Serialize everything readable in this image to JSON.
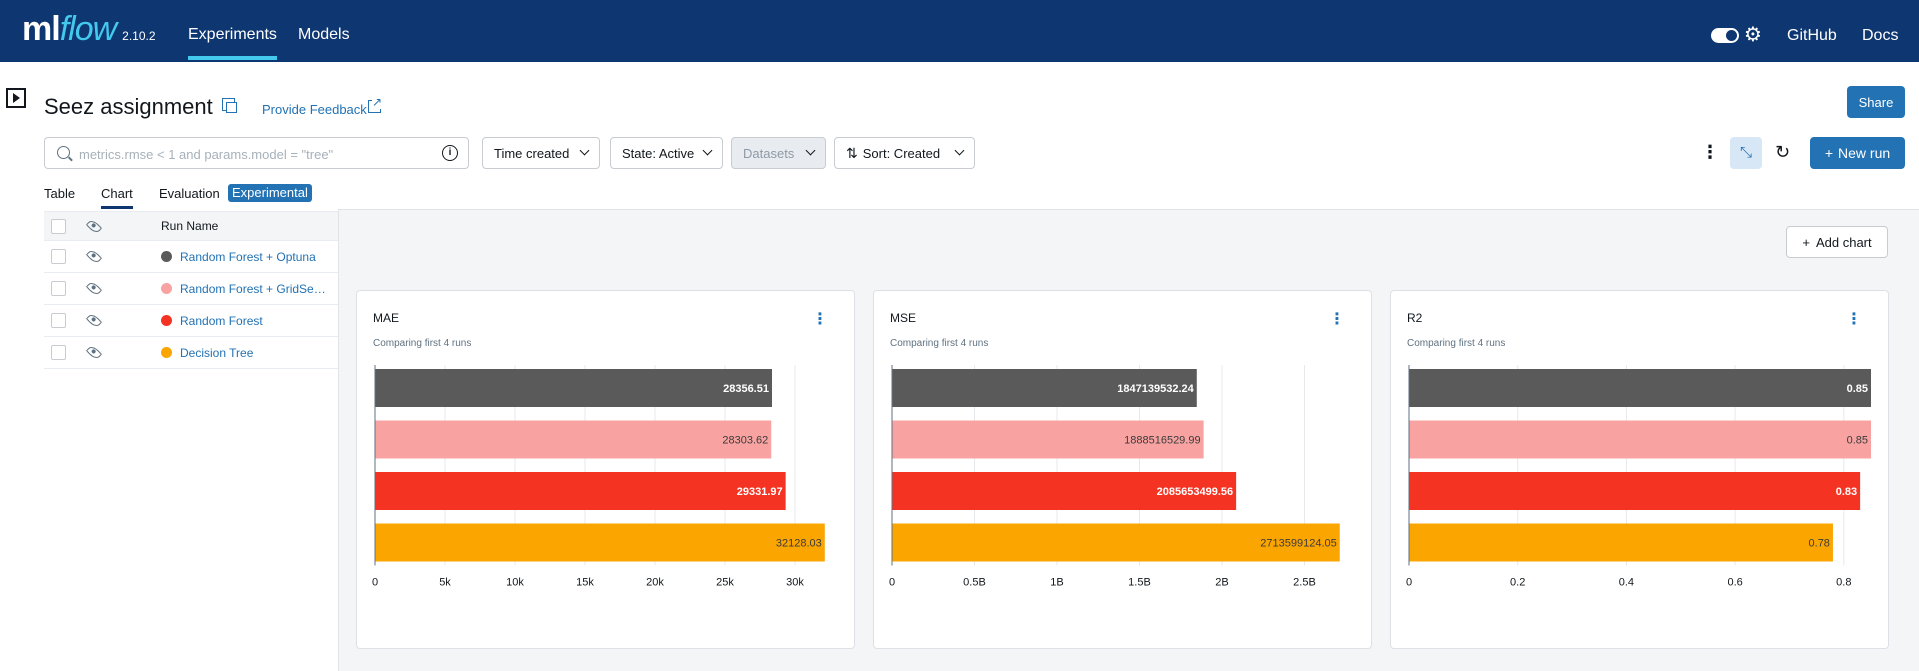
{
  "header": {
    "logo_ml": "ml",
    "logo_flow": "flow",
    "version": "2.10.2",
    "nav": [
      "Experiments",
      "Models"
    ],
    "links": [
      "GitHub",
      "Docs"
    ]
  },
  "experiment": {
    "title": "Seez assignment",
    "feedback": "Provide Feedback",
    "share": "Share"
  },
  "filters": {
    "search_placeholder": "metrics.rmse < 1 and params.model = \"tree\"",
    "time_created": "Time created",
    "state": "State: Active",
    "datasets": "Datasets",
    "sort": "Sort: Created",
    "new_run": "New run"
  },
  "tabs": [
    "Table",
    "Chart",
    "Evaluation",
    "Experimental"
  ],
  "runs": {
    "column": "Run Name",
    "items": [
      {
        "name": "Random Forest + Optuna",
        "color": "#5a5a5a"
      },
      {
        "name": "Random Forest + GridSea...",
        "color": "#f8a3a1"
      },
      {
        "name": "Random Forest",
        "color": "#f53322"
      },
      {
        "name": "Decision Tree",
        "color": "#fba500"
      }
    ]
  },
  "add_chart": "Add chart",
  "chart_data": [
    {
      "type": "bar",
      "title": "MAE",
      "subtitle": "Comparing first 4 runs",
      "categories": [
        "Random Forest + Optuna",
        "Random Forest + GridSea...",
        "Random Forest",
        "Decision Tree"
      ],
      "values": [
        28356.51,
        28303.62,
        29331.97,
        32128.03
      ],
      "labels": [
        "28356.51",
        "28303.62",
        "29331.97",
        "32128.03"
      ],
      "colors": [
        "#5a5a5a",
        "#f8a3a1",
        "#f53322",
        "#fba500"
      ],
      "xlim": [
        0,
        33000
      ],
      "ticks": [
        0,
        5000,
        10000,
        15000,
        20000,
        25000,
        30000
      ],
      "tick_labels": [
        "0",
        "5k",
        "10k",
        "15k",
        "20k",
        "25k",
        "30k"
      ]
    },
    {
      "type": "bar",
      "title": "MSE",
      "subtitle": "Comparing first 4 runs",
      "categories": [
        "Random Forest + Optuna",
        "Random Forest + GridSea...",
        "Random Forest",
        "Decision Tree"
      ],
      "values": [
        1847139532.24,
        1888516529.99,
        2085653499.56,
        2713599124.05
      ],
      "labels": [
        "1847139532.24",
        "1888516529.99",
        "2085653499.56",
        "2713599124.05"
      ],
      "colors": [
        "#5a5a5a",
        "#f8a3a1",
        "#f53322",
        "#fba500"
      ],
      "xlim": [
        0,
        2800000000
      ],
      "ticks": [
        0,
        500000000,
        1000000000,
        1500000000,
        2000000000,
        2500000000
      ],
      "tick_labels": [
        "0",
        "0.5B",
        "1B",
        "1.5B",
        "2B",
        "2.5B"
      ]
    },
    {
      "type": "bar",
      "title": "R2",
      "subtitle": "Comparing first 4 runs",
      "categories": [
        "Random Forest + Optuna",
        "Random Forest + GridSea...",
        "Random Forest",
        "Decision Tree"
      ],
      "values": [
        0.85,
        0.85,
        0.83,
        0.78
      ],
      "labels": [
        "0.85",
        "0.85",
        "0.83",
        "0.78"
      ],
      "colors": [
        "#5a5a5a",
        "#f8a3a1",
        "#f53322",
        "#fba500"
      ],
      "xlim": [
        0,
        0.85
      ],
      "ticks": [
        0,
        0.2,
        0.4,
        0.6,
        0.8
      ],
      "tick_labels": [
        "0",
        "0.2",
        "0.4",
        "0.6",
        "0.8"
      ]
    }
  ]
}
